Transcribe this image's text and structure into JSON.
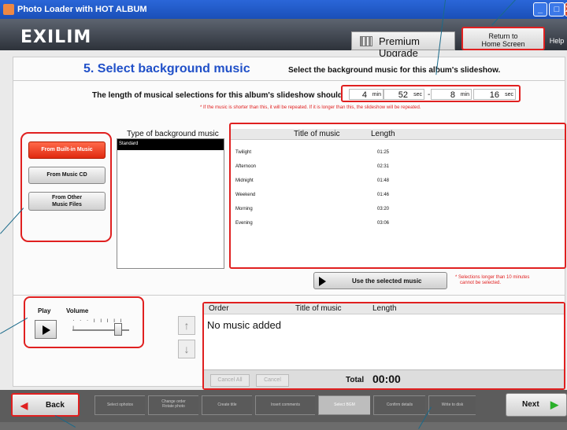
{
  "window": {
    "title": "Photo Loader with HOT ALBUM",
    "min": "_",
    "max": "□",
    "close": "X"
  },
  "header": {
    "logo": "EXILIM",
    "premium": "Premium Upgrade",
    "return_line1": "Return to",
    "return_line2": "Home Screen",
    "help": "Help"
  },
  "step": {
    "title": "5. Select background music",
    "desc": "Select the background music for this album's slideshow."
  },
  "length": {
    "label": "The length of musical selections for this album's slideshow should be",
    "min1": "4",
    "sec1": "52",
    "min2": "8",
    "sec2": "16",
    "unit_min": "min",
    "unit_sec": "sec",
    "dash": "-",
    "warning": "* If the music is shorter than this, it will be repeated. If it is longer than this, the slideshow will be repeated."
  },
  "sources": {
    "builtin": "From Built-in Music",
    "cd": "From Music CD",
    "other1": "From Other",
    "other2": "Music Files"
  },
  "type_list": {
    "label": "Type of background music",
    "item": "Standard"
  },
  "music": {
    "col_title": "Title of music",
    "col_length": "Length",
    "rows": [
      {
        "title": "Twilight",
        "length": "01:25"
      },
      {
        "title": "Afternoon",
        "length": "02:31"
      },
      {
        "title": "Midnight",
        "length": "01:48"
      },
      {
        "title": "Weekend",
        "length": "01:46"
      },
      {
        "title": "Morning",
        "length": "03:20"
      },
      {
        "title": "Evening",
        "length": "03:06"
      }
    ]
  },
  "use_btn": "Use the selected music",
  "warning2_line1": "* Selections longer than 10 minutes",
  "warning2_line2": "cannot be selected.",
  "player": {
    "play": "Play",
    "volume": "Volume",
    "ticks": "· · · ı ı ı ı ı ı",
    "volume_level": 0.8
  },
  "order": {
    "col_order": "Order",
    "col_title": "Title of music",
    "col_length": "Length",
    "empty": "No music added",
    "cancel_all": "Cancel All",
    "cancel": "Cancel",
    "total_label": "Total",
    "total_val": "00:00"
  },
  "nav": {
    "back": "Back",
    "next": "Next",
    "steps": [
      {
        "l1": "Select ophotos",
        "l2": ""
      },
      {
        "l1": "Change order",
        "l2": "Rotate photo"
      },
      {
        "l1": "Create title",
        "l2": ""
      },
      {
        "l1": "Insert comments",
        "l2": ""
      },
      {
        "l1": "Select BGM",
        "l2": ""
      },
      {
        "l1": "Confirm details",
        "l2": ""
      },
      {
        "l1": "Write to disk",
        "l2": ""
      }
    ]
  },
  "colors": {
    "accent": "#2050c8",
    "highlight": "#e02020",
    "selected_source": "#e8341a"
  }
}
